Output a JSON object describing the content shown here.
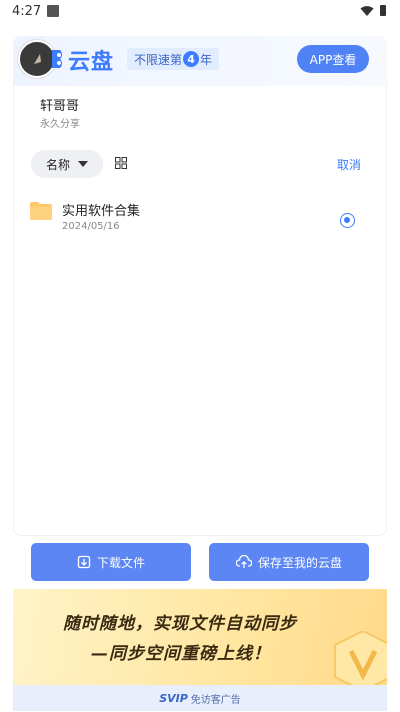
{
  "status_bar": {
    "time": "4:27"
  },
  "header": {
    "brand_text": "云盘",
    "promo_prefix": "不限速第",
    "promo_number": "4",
    "promo_suffix": "年",
    "app_button_label": "APP查看"
  },
  "share": {
    "user_name": "轩哥哥",
    "share_type": "永久分享"
  },
  "toolbar": {
    "sort_label": "名称",
    "cancel_label": "取消"
  },
  "files": [
    {
      "name": "实用软件合集",
      "date": "2024/05/16",
      "selected": true
    }
  ],
  "actions": {
    "download_label": "下载文件",
    "save_label": "保存至我的云盘"
  },
  "ad": {
    "line1": "随时随地，实现文件自动同步",
    "line2": "—同步空间重磅上线！",
    "footer_logo": "SVIP",
    "footer_text": "免访客广告"
  },
  "colors": {
    "accent": "#3d7bff",
    "button": "#5b86f3",
    "folder": "#ffc869"
  },
  "icons": [
    "wifi-icon",
    "battery-icon",
    "logo-icon",
    "caret-down-icon",
    "grid-view-icon",
    "folder-icon",
    "radio-checked-icon",
    "download-file-icon",
    "cloud-upload-icon"
  ]
}
